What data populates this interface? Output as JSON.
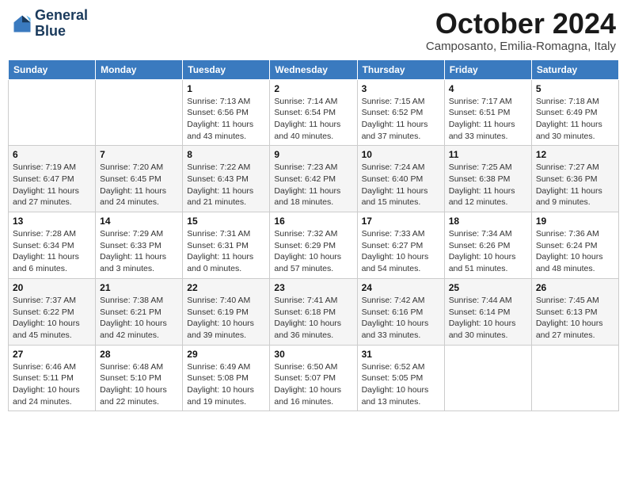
{
  "header": {
    "logo_line1": "General",
    "logo_line2": "Blue",
    "month_title": "October 2024",
    "location": "Camposanto, Emilia-Romagna, Italy"
  },
  "weekdays": [
    "Sunday",
    "Monday",
    "Tuesday",
    "Wednesday",
    "Thursday",
    "Friday",
    "Saturday"
  ],
  "weeks": [
    [
      {
        "day": "",
        "sunrise": "",
        "sunset": "",
        "daylight": ""
      },
      {
        "day": "",
        "sunrise": "",
        "sunset": "",
        "daylight": ""
      },
      {
        "day": "1",
        "sunrise": "Sunrise: 7:13 AM",
        "sunset": "Sunset: 6:56 PM",
        "daylight": "Daylight: 11 hours and 43 minutes."
      },
      {
        "day": "2",
        "sunrise": "Sunrise: 7:14 AM",
        "sunset": "Sunset: 6:54 PM",
        "daylight": "Daylight: 11 hours and 40 minutes."
      },
      {
        "day": "3",
        "sunrise": "Sunrise: 7:15 AM",
        "sunset": "Sunset: 6:52 PM",
        "daylight": "Daylight: 11 hours and 37 minutes."
      },
      {
        "day": "4",
        "sunrise": "Sunrise: 7:17 AM",
        "sunset": "Sunset: 6:51 PM",
        "daylight": "Daylight: 11 hours and 33 minutes."
      },
      {
        "day": "5",
        "sunrise": "Sunrise: 7:18 AM",
        "sunset": "Sunset: 6:49 PM",
        "daylight": "Daylight: 11 hours and 30 minutes."
      }
    ],
    [
      {
        "day": "6",
        "sunrise": "Sunrise: 7:19 AM",
        "sunset": "Sunset: 6:47 PM",
        "daylight": "Daylight: 11 hours and 27 minutes."
      },
      {
        "day": "7",
        "sunrise": "Sunrise: 7:20 AM",
        "sunset": "Sunset: 6:45 PM",
        "daylight": "Daylight: 11 hours and 24 minutes."
      },
      {
        "day": "8",
        "sunrise": "Sunrise: 7:22 AM",
        "sunset": "Sunset: 6:43 PM",
        "daylight": "Daylight: 11 hours and 21 minutes."
      },
      {
        "day": "9",
        "sunrise": "Sunrise: 7:23 AM",
        "sunset": "Sunset: 6:42 PM",
        "daylight": "Daylight: 11 hours and 18 minutes."
      },
      {
        "day": "10",
        "sunrise": "Sunrise: 7:24 AM",
        "sunset": "Sunset: 6:40 PM",
        "daylight": "Daylight: 11 hours and 15 minutes."
      },
      {
        "day": "11",
        "sunrise": "Sunrise: 7:25 AM",
        "sunset": "Sunset: 6:38 PM",
        "daylight": "Daylight: 11 hours and 12 minutes."
      },
      {
        "day": "12",
        "sunrise": "Sunrise: 7:27 AM",
        "sunset": "Sunset: 6:36 PM",
        "daylight": "Daylight: 11 hours and 9 minutes."
      }
    ],
    [
      {
        "day": "13",
        "sunrise": "Sunrise: 7:28 AM",
        "sunset": "Sunset: 6:34 PM",
        "daylight": "Daylight: 11 hours and 6 minutes."
      },
      {
        "day": "14",
        "sunrise": "Sunrise: 7:29 AM",
        "sunset": "Sunset: 6:33 PM",
        "daylight": "Daylight: 11 hours and 3 minutes."
      },
      {
        "day": "15",
        "sunrise": "Sunrise: 7:31 AM",
        "sunset": "Sunset: 6:31 PM",
        "daylight": "Daylight: 11 hours and 0 minutes."
      },
      {
        "day": "16",
        "sunrise": "Sunrise: 7:32 AM",
        "sunset": "Sunset: 6:29 PM",
        "daylight": "Daylight: 10 hours and 57 minutes."
      },
      {
        "day": "17",
        "sunrise": "Sunrise: 7:33 AM",
        "sunset": "Sunset: 6:27 PM",
        "daylight": "Daylight: 10 hours and 54 minutes."
      },
      {
        "day": "18",
        "sunrise": "Sunrise: 7:34 AM",
        "sunset": "Sunset: 6:26 PM",
        "daylight": "Daylight: 10 hours and 51 minutes."
      },
      {
        "day": "19",
        "sunrise": "Sunrise: 7:36 AM",
        "sunset": "Sunset: 6:24 PM",
        "daylight": "Daylight: 10 hours and 48 minutes."
      }
    ],
    [
      {
        "day": "20",
        "sunrise": "Sunrise: 7:37 AM",
        "sunset": "Sunset: 6:22 PM",
        "daylight": "Daylight: 10 hours and 45 minutes."
      },
      {
        "day": "21",
        "sunrise": "Sunrise: 7:38 AM",
        "sunset": "Sunset: 6:21 PM",
        "daylight": "Daylight: 10 hours and 42 minutes."
      },
      {
        "day": "22",
        "sunrise": "Sunrise: 7:40 AM",
        "sunset": "Sunset: 6:19 PM",
        "daylight": "Daylight: 10 hours and 39 minutes."
      },
      {
        "day": "23",
        "sunrise": "Sunrise: 7:41 AM",
        "sunset": "Sunset: 6:18 PM",
        "daylight": "Daylight: 10 hours and 36 minutes."
      },
      {
        "day": "24",
        "sunrise": "Sunrise: 7:42 AM",
        "sunset": "Sunset: 6:16 PM",
        "daylight": "Daylight: 10 hours and 33 minutes."
      },
      {
        "day": "25",
        "sunrise": "Sunrise: 7:44 AM",
        "sunset": "Sunset: 6:14 PM",
        "daylight": "Daylight: 10 hours and 30 minutes."
      },
      {
        "day": "26",
        "sunrise": "Sunrise: 7:45 AM",
        "sunset": "Sunset: 6:13 PM",
        "daylight": "Daylight: 10 hours and 27 minutes."
      }
    ],
    [
      {
        "day": "27",
        "sunrise": "Sunrise: 6:46 AM",
        "sunset": "Sunset: 5:11 PM",
        "daylight": "Daylight: 10 hours and 24 minutes."
      },
      {
        "day": "28",
        "sunrise": "Sunrise: 6:48 AM",
        "sunset": "Sunset: 5:10 PM",
        "daylight": "Daylight: 10 hours and 22 minutes."
      },
      {
        "day": "29",
        "sunrise": "Sunrise: 6:49 AM",
        "sunset": "Sunset: 5:08 PM",
        "daylight": "Daylight: 10 hours and 19 minutes."
      },
      {
        "day": "30",
        "sunrise": "Sunrise: 6:50 AM",
        "sunset": "Sunset: 5:07 PM",
        "daylight": "Daylight: 10 hours and 16 minutes."
      },
      {
        "day": "31",
        "sunrise": "Sunrise: 6:52 AM",
        "sunset": "Sunset: 5:05 PM",
        "daylight": "Daylight: 10 hours and 13 minutes."
      },
      {
        "day": "",
        "sunrise": "",
        "sunset": "",
        "daylight": ""
      },
      {
        "day": "",
        "sunrise": "",
        "sunset": "",
        "daylight": ""
      }
    ]
  ]
}
